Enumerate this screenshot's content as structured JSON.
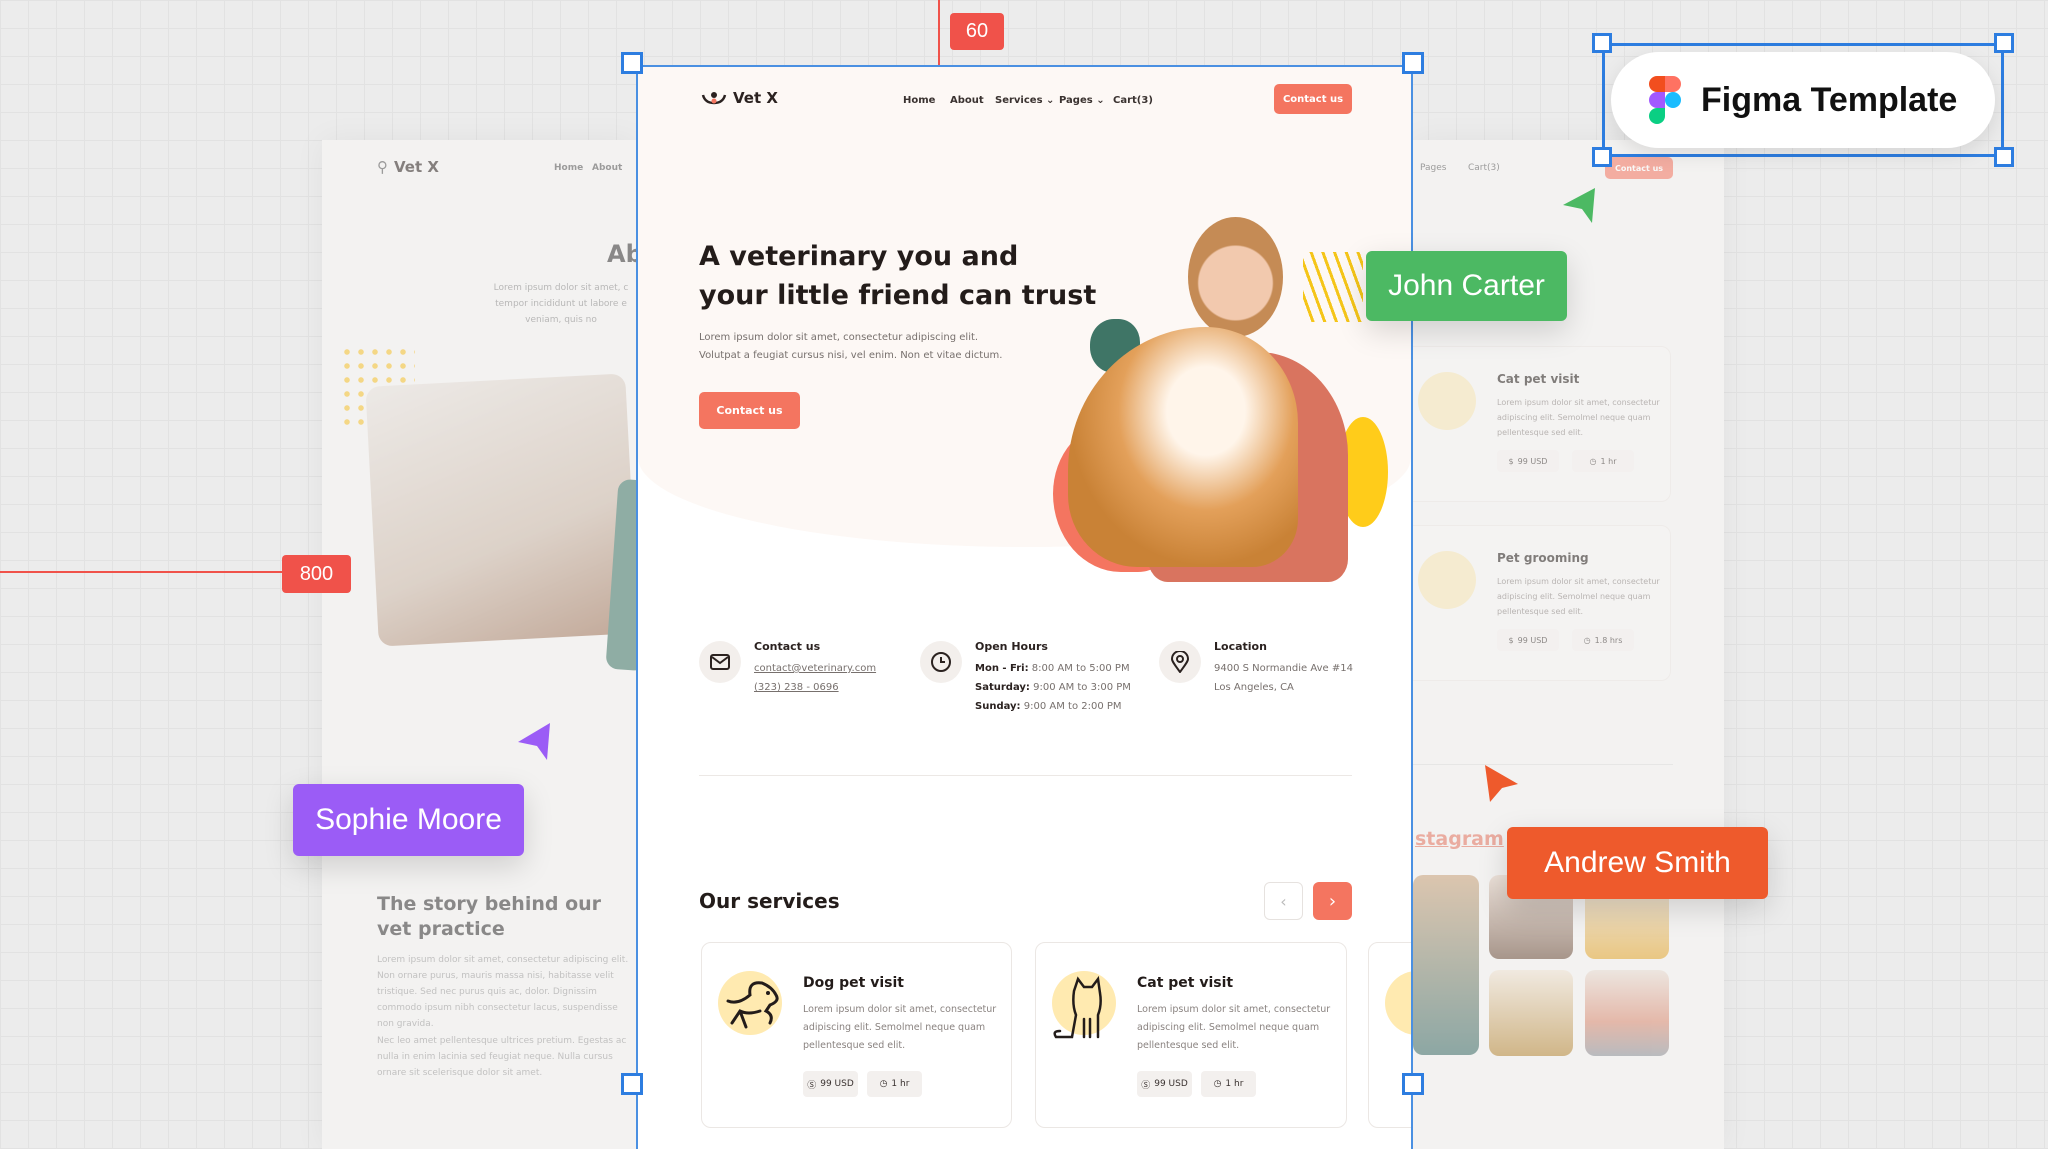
{
  "canvas": {
    "ruler_top": "60",
    "ruler_left": "800",
    "badge": "Figma Template"
  },
  "collaborators": [
    {
      "name": "John Carter",
      "color": "#4cb963"
    },
    {
      "name": "Sophie Moore",
      "color": "#9b5cf6"
    },
    {
      "name": "Andrew Smith",
      "color": "#ee5a2c"
    }
  ],
  "colors": {
    "accent": "#f47560",
    "dark": "#231c1a",
    "teal": "#3f7566",
    "yellow": "#ffcc1a",
    "selection": "#2d7de0"
  },
  "nav": {
    "brand": "Vet X",
    "links": [
      "Home",
      "About",
      "Services",
      "Pages",
      "Cart(3)"
    ],
    "cta": "Contact us"
  },
  "hero": {
    "title_line1": "A veterinary you and",
    "title_line2": "your little friend can trust",
    "text_line1": "Lorem ipsum dolor sit amet, consectetur adipiscing elit.",
    "text_line2": "Volutpat a feugiat cursus nisi, vel enim. Non et vitae dictum.",
    "cta": "Contact us"
  },
  "info": {
    "contact": {
      "title": "Contact us",
      "email": "contact@veterinary.com",
      "phone": "(323) 238 - 0696"
    },
    "hours": {
      "title": "Open Hours",
      "rows": [
        {
          "day": "Mon - Fri:",
          "time": "8:00 AM to 5:00 PM"
        },
        {
          "day": "Saturday:",
          "time": "9:00 AM to 3:00 PM"
        },
        {
          "day": "Sunday:",
          "time": "9:00 AM to 2:00 PM"
        }
      ]
    },
    "location": {
      "title": "Location",
      "line1": "9400 S Normandie Ave #14",
      "line2": "Los Angeles, CA"
    }
  },
  "services": {
    "title": "Our services",
    "cards": [
      {
        "title": "Dog pet visit",
        "text": "Lorem ipsum dolor sit amet, consectetur adipiscing elit. Semolmel neque quam pellentesque sed elit.",
        "price": "99 USD",
        "duration": "1 hr"
      },
      {
        "title": "Cat pet visit",
        "text": "Lorem ipsum dolor sit amet, consectetur adipiscing elit. Semolmel neque quam pellentesque sed elit.",
        "price": "99 USD",
        "duration": "1 hr"
      }
    ]
  },
  "left_page": {
    "brand": "Vet X",
    "links": [
      "Home",
      "About"
    ],
    "heading": "Ab",
    "intro": "Lorem ipsum dolor sit amet, c tempor incididunt ut labore e veniam, quis no",
    "story_title": "The story behind our vet practice",
    "story_p1": "Lorem ipsum dolor sit amet, consectetur adipiscing elit. Non ornare purus, mauris massa nisi, habitasse velit tristique. Sed nec purus quis ac, dolor. Dignissim commodo ipsum nibh consectetur lacus, suspendisse non gravida.",
    "story_p2": "Nec leo amet pellentesque ultrices pretium. Egestas ac nulla in enim lacinia sed feugiat neque. Nulla cursus ornare sit scelerisque dolor sit amet."
  },
  "right_page": {
    "links": [
      "Pages",
      "Cart(3)"
    ],
    "cta": "Contact us",
    "cards": [
      {
        "title": "Cat pet visit",
        "text": "Lorem ipsum dolor sit amet, consectetur adipiscing elit. Semolmel neque quam pellentesque sed elit.",
        "price": "99 USD",
        "duration": "1 hr"
      },
      {
        "title": "Pet grooming",
        "text": "Lorem ipsum dolor sit amet, consectetur adipiscing elit. Semolmel neque quam pellentesque sed elit.",
        "price": "99 USD",
        "duration": "1.8 hrs"
      }
    ],
    "instagram": "stagram"
  }
}
